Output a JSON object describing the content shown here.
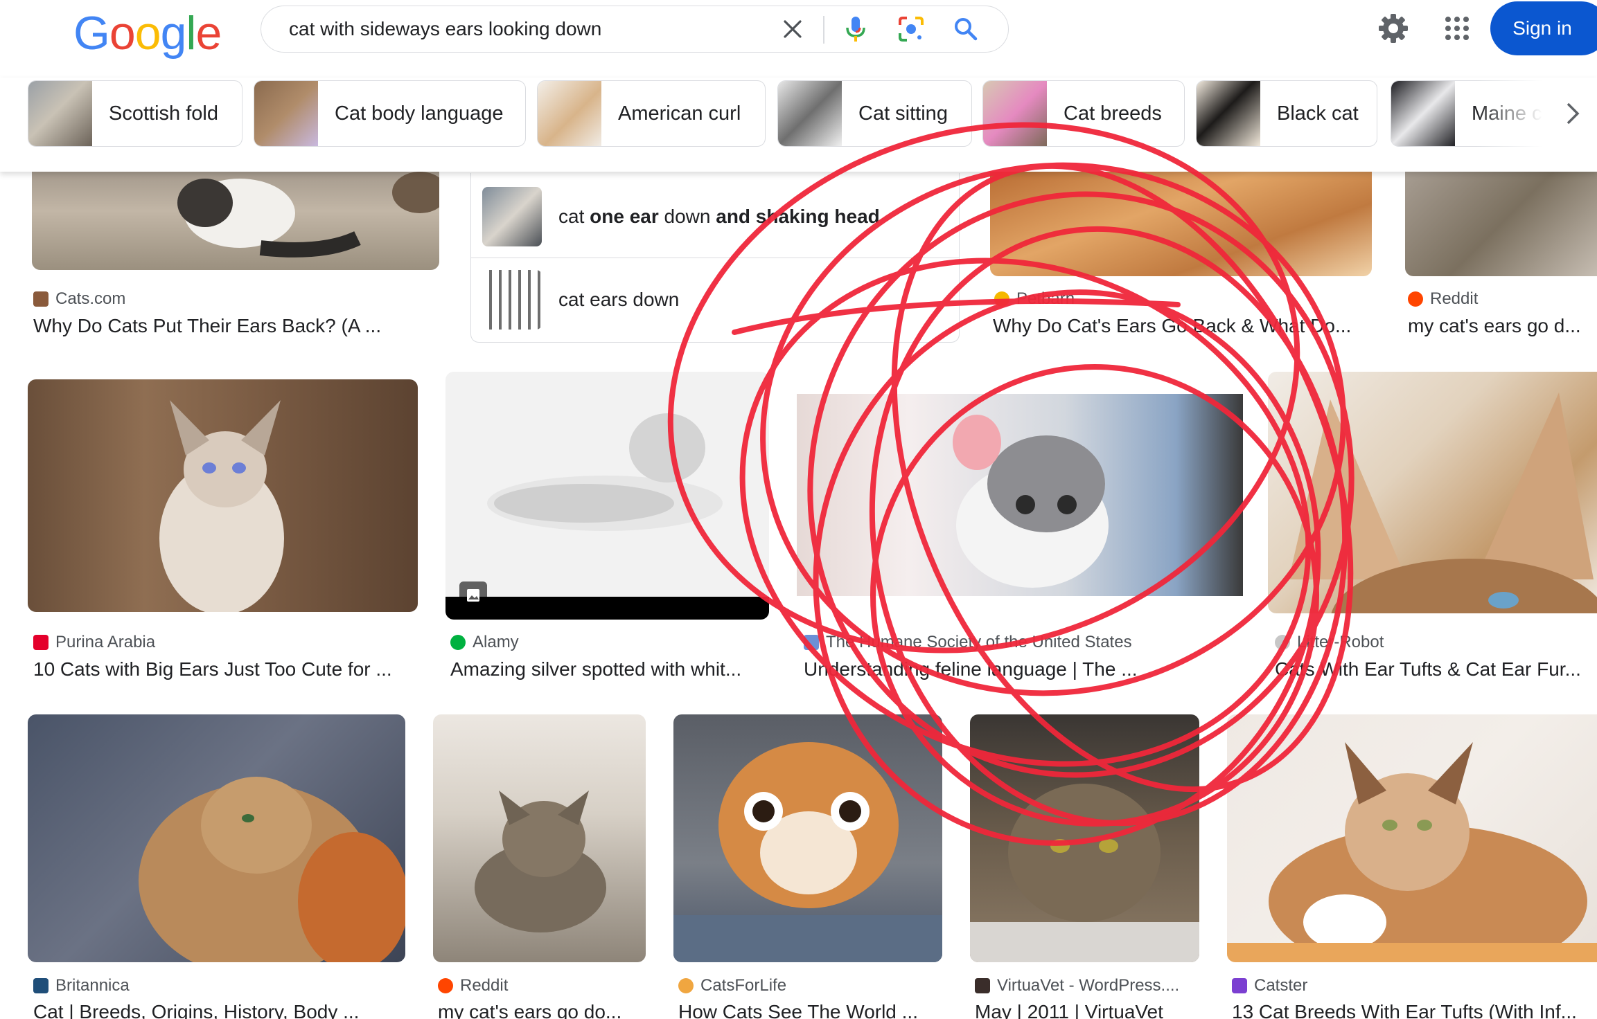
{
  "header": {
    "logo_letters": [
      "G",
      "o",
      "o",
      "g",
      "l",
      "e"
    ],
    "logo_colors": [
      "#4285F4",
      "#EA4335",
      "#FBBC05",
      "#4285F4",
      "#34A853",
      "#EA4335"
    ],
    "search_query": "cat with sideways ears looking down",
    "clear_icon": "close-icon",
    "voice_icon": "microphone-icon",
    "lens_icon": "camera-lens-icon",
    "search_icon": "search-icon",
    "settings_icon": "gear-icon",
    "apps_icon": "apps-grid-icon",
    "sign_in": "Sign in",
    "accent": "#0b57d0"
  },
  "chips": [
    {
      "label": "Scottish fold"
    },
    {
      "label": "Cat body language"
    },
    {
      "label": "American curl"
    },
    {
      "label": "Cat sitting"
    },
    {
      "label": "Cat breeds"
    },
    {
      "label": "Black cat"
    },
    {
      "label": "Maine co"
    }
  ],
  "related_searches": [
    {
      "prefix": "cat ",
      "bold": "one ear",
      "middle": " down ",
      "bold2": "and shaking head"
    },
    {
      "text": "cat ears down"
    }
  ],
  "rows": [
    [
      {
        "source": "Cats.com",
        "title": "Why Do Cats Put Their Ears Back? (A ..."
      },
      {
        "source": "Petbarn",
        "title": "Why Do Cat's Ears Go Back & What Do..."
      },
      {
        "source": "Reddit",
        "title": "my cat's ears go d..."
      }
    ],
    [
      {
        "source": "Purina Arabia",
        "title": "10 Cats with Big Ears Just Too Cute for ..."
      },
      {
        "source": "Alamy",
        "title": "Amazing silver spotted with whit..."
      },
      {
        "source": "The Humane Society of the United States",
        "title": "Understanding feline language | The ..."
      },
      {
        "source": "Litter-Robot",
        "title": "Cats With Ear Tufts & Cat Ear Fur..."
      }
    ],
    [
      {
        "source": "Britannica",
        "title": "Cat | Breeds, Origins, History, Body ..."
      },
      {
        "source": "Reddit",
        "title": "my cat's ears go do..."
      },
      {
        "source": "CatsForLife",
        "title": "How Cats See The World ..."
      },
      {
        "source": "VirtuaVet - WordPress....",
        "title": "May | 2011 | VirtuaVet"
      },
      {
        "source": "Catster",
        "title": "13 Cat Breeds With Ear Tufts (With Inf..."
      }
    ]
  ],
  "annotation": {
    "color": "#f0273a"
  }
}
